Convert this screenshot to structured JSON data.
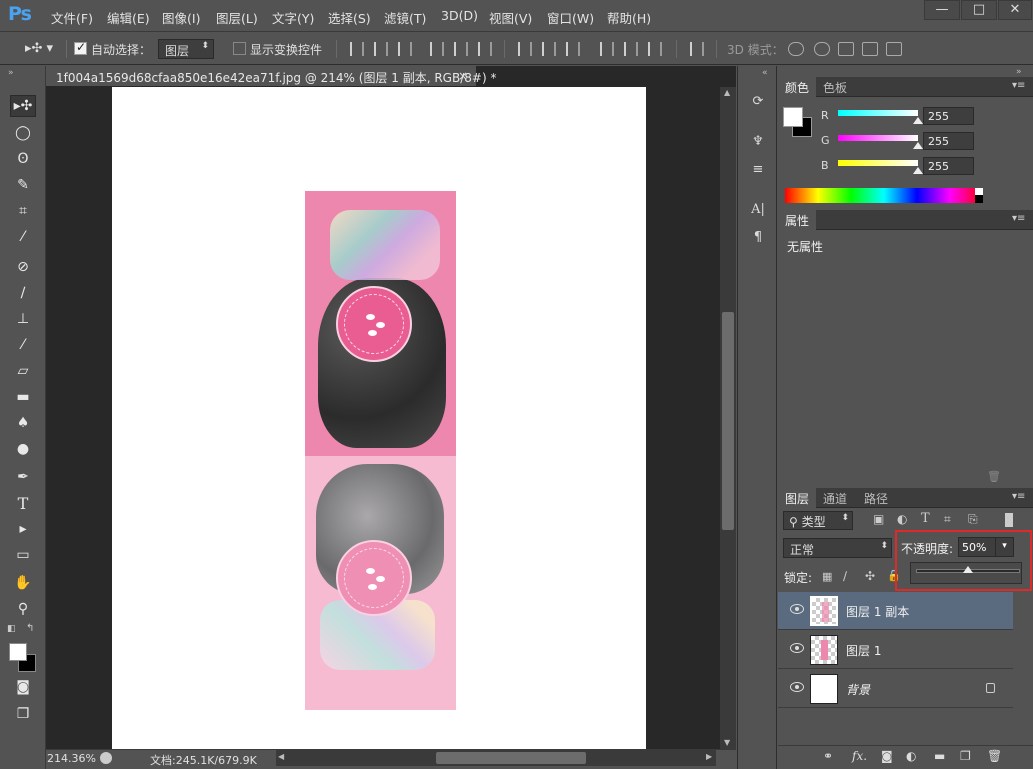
{
  "app": {
    "logo": "Ps"
  },
  "menu": [
    "文件(F)",
    "编辑(E)",
    "图像(I)",
    "图层(L)",
    "文字(Y)",
    "选择(S)",
    "滤镜(T)",
    "3D(D)",
    "视图(V)",
    "窗口(W)",
    "帮助(H)"
  ],
  "window_controls": {
    "minimize": "—",
    "maximize": "□",
    "close": "✕"
  },
  "options": {
    "auto_select_label": "自动选择：",
    "auto_select_checked": true,
    "auto_select_target": "图层",
    "show_transform_label": "显示变换控件",
    "mode3d_label": "3D 模式："
  },
  "document": {
    "tab_title": "1f004a1569d68cfaa850e16e42ea71f.jpg @ 214% (图层 1 副本, RGB/8#) *",
    "tab_close": "×",
    "zoom": "214.36%",
    "doc_size": "文档:245.1K/679.9K"
  },
  "color_panel": {
    "tabs": [
      "颜色",
      "色板"
    ],
    "channels": [
      {
        "label": "R",
        "value": "255",
        "color": "#00ffff"
      },
      {
        "label": "G",
        "value": "255",
        "color": "#ff00ff"
      },
      {
        "label": "B",
        "value": "255",
        "color": "#ffff00"
      }
    ]
  },
  "properties_panel": {
    "tab": "属性",
    "content": "无属性"
  },
  "layers_panel": {
    "tabs": [
      "图层",
      "通道",
      "路径"
    ],
    "filter_kind": "类型",
    "blend_mode": "正常",
    "opacity_label": "不透明度:",
    "opacity_value": "50%",
    "opacity_fraction": 0.5,
    "lock_label": "锁定:",
    "layers": [
      {
        "name": "图层 1 副本",
        "selected": true,
        "locked": false
      },
      {
        "name": "图层 1",
        "selected": false,
        "locked": false
      },
      {
        "name": "背景",
        "selected": false,
        "locked": true
      }
    ]
  },
  "colors": {
    "accent": "#4aa3f0",
    "highlight_border": "#e02a2a",
    "selected_layer": "#5a6b80"
  }
}
